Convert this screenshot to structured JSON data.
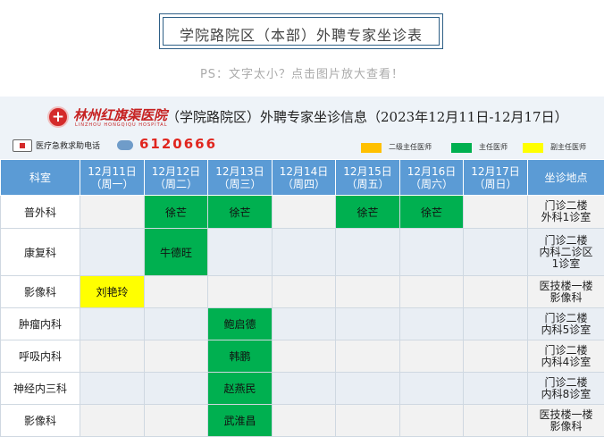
{
  "page_title": "学院路院区（本部）外聘专家坐诊表",
  "ps_text": "PS：文字太小？点击图片放大查看！",
  "hospital": {
    "name_cn": "林州红旗渠医院",
    "name_en": "LINZHOU HONGQIQU HOSPITAL",
    "sheet_title": "（学院路院区）外聘专家坐诊信息（2023年12月11日-12月17日）",
    "hotline_label": "医疗急救求助电话",
    "hotline_number": "6120666"
  },
  "legend": [
    {
      "label": "二级主任医师",
      "color": "#ffc000"
    },
    {
      "label": "主任医师",
      "color": "#00b050"
    },
    {
      "label": "副主任医师",
      "color": "#ffff00"
    }
  ],
  "table": {
    "dept_header": "科室",
    "location_header": "坐诊地点",
    "days": [
      {
        "date": "12月11日",
        "weekday": "（周一）"
      },
      {
        "date": "12月12日",
        "weekday": "（周二）"
      },
      {
        "date": "12月13日",
        "weekday": "（周三）"
      },
      {
        "date": "12月14日",
        "weekday": "（周四）"
      },
      {
        "date": "12月15日",
        "weekday": "（周五）"
      },
      {
        "date": "12月16日",
        "weekday": "（周六）"
      },
      {
        "date": "12月17日",
        "weekday": "（周日）"
      }
    ],
    "rows": [
      {
        "dept": "普外科",
        "cells": [
          "",
          "徐芒",
          "徐芒",
          "",
          "徐芒",
          "徐芒",
          ""
        ],
        "levels": [
          "",
          "主任医师",
          "主任医师",
          "",
          "主任医师",
          "主任医师",
          ""
        ],
        "location": [
          "门诊二楼",
          "外科1诊室"
        ]
      },
      {
        "dept": "康复科",
        "cells": [
          "",
          "牛德旺",
          "",
          "",
          "",
          "",
          ""
        ],
        "levels": [
          "",
          "主任医师",
          "",
          "",
          "",
          "",
          ""
        ],
        "location": [
          "门诊二楼",
          "内科二诊区",
          "1诊室"
        ]
      },
      {
        "dept": "影像科",
        "cells": [
          "刘艳玲",
          "",
          "",
          "",
          "",
          "",
          ""
        ],
        "levels": [
          "副主任医师",
          "",
          "",
          "",
          "",
          "",
          ""
        ],
        "location": [
          "医技楼一楼",
          "影像科"
        ]
      },
      {
        "dept": "肿瘤内科",
        "cells": [
          "",
          "",
          "鲍启德",
          "",
          "",
          "",
          ""
        ],
        "levels": [
          "",
          "",
          "主任医师",
          "",
          "",
          "",
          ""
        ],
        "location": [
          "门诊二楼",
          "内科5诊室"
        ]
      },
      {
        "dept": "呼吸内科",
        "cells": [
          "",
          "",
          "韩鹏",
          "",
          "",
          "",
          ""
        ],
        "levels": [
          "",
          "",
          "主任医师",
          "",
          "",
          "",
          ""
        ],
        "location": [
          "门诊二楼",
          "内科4诊室"
        ]
      },
      {
        "dept": "神经内三科",
        "cells": [
          "",
          "",
          "赵燕民",
          "",
          "",
          "",
          ""
        ],
        "levels": [
          "",
          "",
          "主任医师",
          "",
          "",
          "",
          ""
        ],
        "location": [
          "门诊二楼",
          "内科8诊室"
        ]
      },
      {
        "dept": "影像科",
        "cells": [
          "",
          "",
          "武淮昌",
          "",
          "",
          "",
          ""
        ],
        "levels": [
          "",
          "",
          "主任医师",
          "",
          "",
          "",
          ""
        ],
        "location": [
          "医技楼一楼",
          "影像科"
        ]
      }
    ]
  }
}
